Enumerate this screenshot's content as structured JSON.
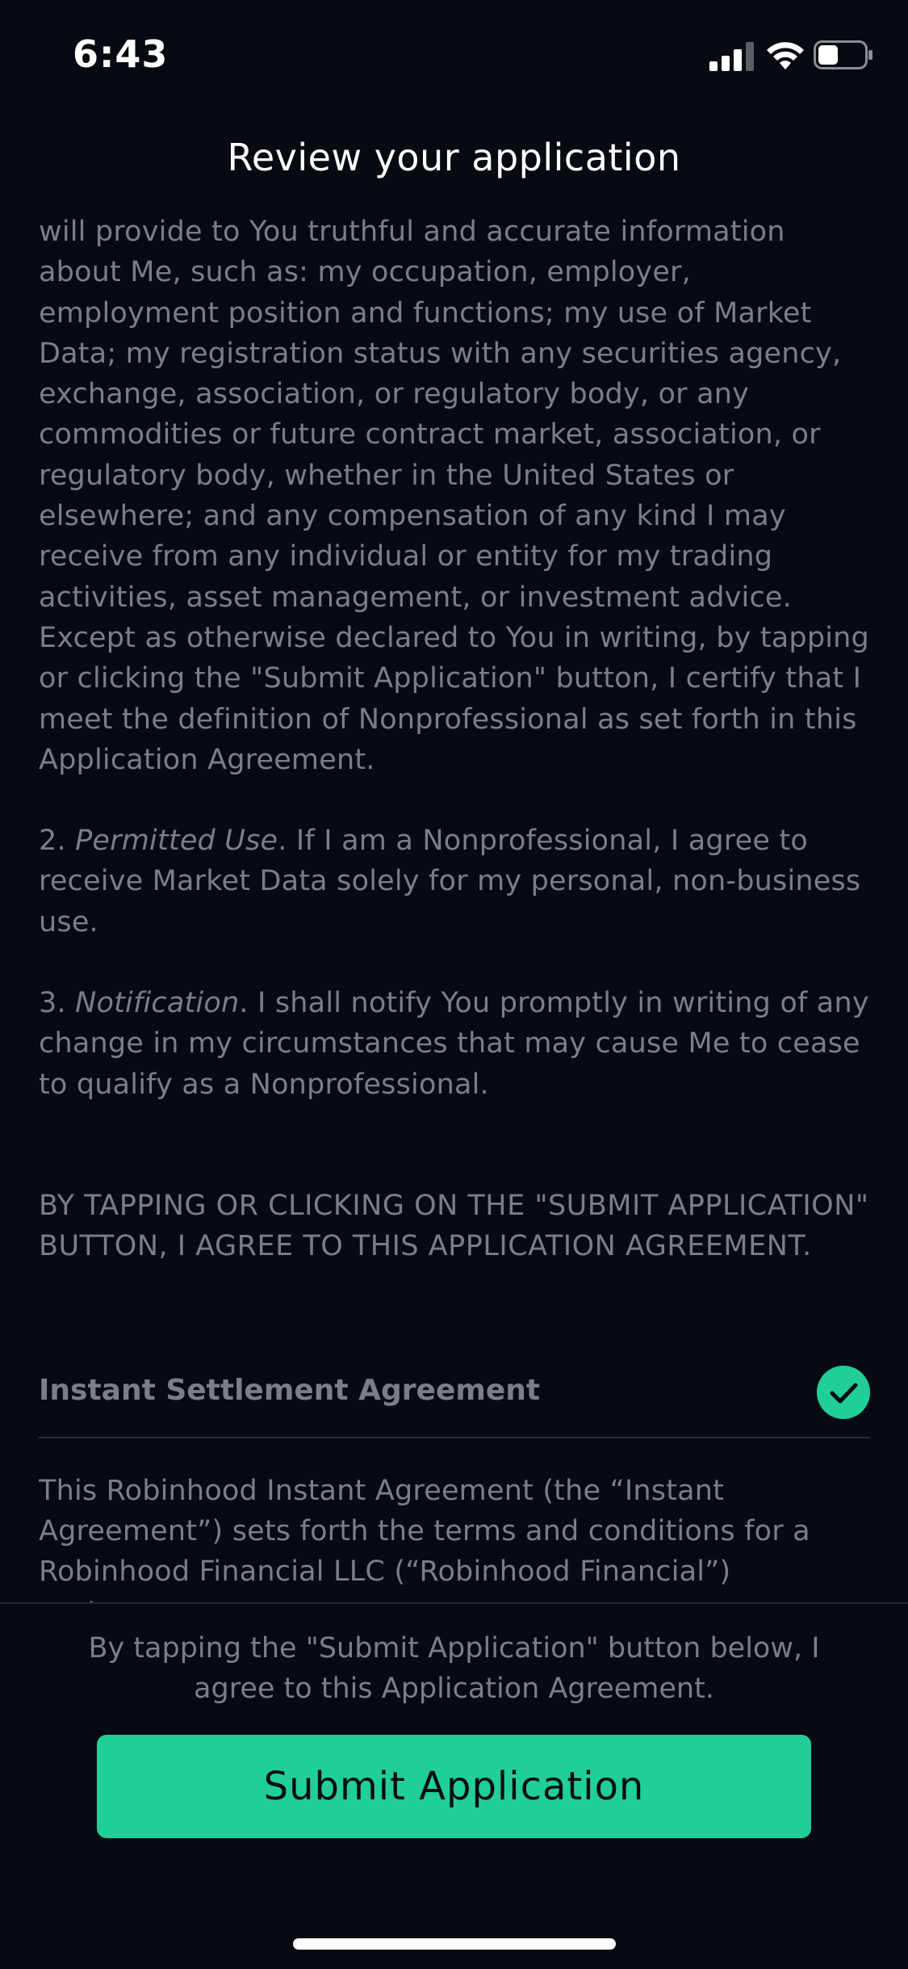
{
  "status_bar": {
    "time": "6:43"
  },
  "header": {
    "title": "Review your application"
  },
  "agreement": {
    "paragraph_1": "will provide to You truthful and accurate information about Me, such as: my occupation, employer, employment position and functions; my use of Market Data; my registration status with any securities agency, exchange, association, or regulatory body, or any commodities or future contract market, association, or regulatory body, whether in the United States or elsewhere; and any compensation of any kind I may receive from any individual or entity for my trading activities, asset management, or investment advice. Except as otherwise declared to You in writing, by tapping or clicking the \"Submit Application\" button, I certify that I meet the definition of Nonprofessional as set forth in this Application Agreement.",
    "item_2_number": "2. ",
    "item_2_title": "Permitted Use",
    "item_2_text": ". If I am a Nonprofessional, I agree to receive Market Data solely for my personal, non-business use.",
    "item_3_number": "3.  ",
    "item_3_title": "Notification",
    "item_3_text": ". I shall notify You promptly in writing of any change in my circumstances that may cause Me to cease to qualify as a Nonprofessional.",
    "caps_statement": "BY TAPPING OR CLICKING ON THE \"SUBMIT APPLICATION\" BUTTON, I AGREE TO THIS APPLICATION AGREEMENT."
  },
  "instant_settlement": {
    "heading": "Instant Settlement Agreement",
    "checked": true,
    "paragraph": "This Robinhood Instant Agreement (the “Instant Agreement”) sets forth the terms and conditions for a Robinhood Financial LLC (“Robinhood Financial”) customer"
  },
  "footer": {
    "consent_text": "By tapping the \"Submit Application\" button below, I agree to this Application Agreement.",
    "submit_label": "Submit Application"
  },
  "colors": {
    "background": "#070b11",
    "accent": "#21ce99",
    "body_text": "#7a7f85"
  }
}
